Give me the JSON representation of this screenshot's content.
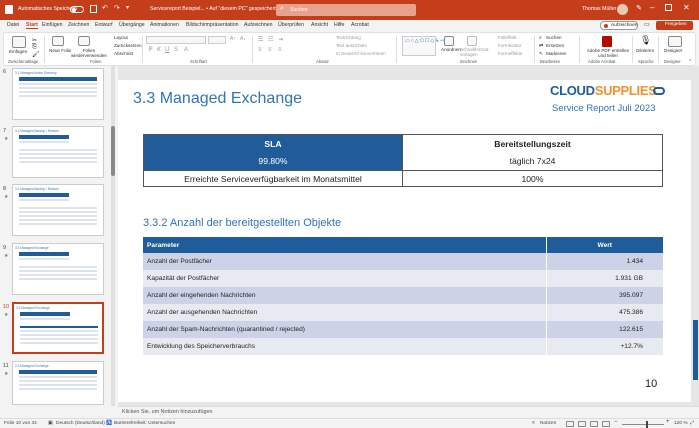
{
  "title_bar": {
    "autosave_label": "Automatisches Speichern",
    "doc_title": "Servicereport Beispiel... • Auf \"diesem PC\" gespeichert",
    "search_placeholder": "Suchen",
    "user_name": "Thomas Müller"
  },
  "ribbon_tabs": [
    "Datei",
    "Start",
    "Einfügen",
    "Zeichnen",
    "Entwurf",
    "Übergänge",
    "Animationen",
    "Bildschirmpräsentation",
    "Aufzeichnen",
    "Überprüfen",
    "Ansicht",
    "Hilfe",
    "Acrobat"
  ],
  "ribbon_right": {
    "record": "Aufzeichnen",
    "share": "Freigeben"
  },
  "ribbon": {
    "paste": "Einfügen",
    "new_slide": "Neue Folie",
    "reuse": "Folien wiederverwenden",
    "layout": "Layout",
    "reset": "Zurücksetzen",
    "section": "Abschnitt",
    "text_direction": "Textrichtung",
    "align_text": "Text ausrichten",
    "smartart": "In SmartArt konvertieren",
    "arrange": "Anordnen",
    "quick_styles": "Schnellformat-vorlagen",
    "fill": "Fülleffekt",
    "outline": "Formkontur",
    "effects": "Formeffekte",
    "find": "Suchen",
    "replace": "Ersetzen",
    "select": "Markieren",
    "pdf": "Adobe PDF erstellen und teilen",
    "dictate": "Diktieren",
    "designer": "Designer",
    "groups": [
      "Zwischenablage",
      "Folien",
      "Schriftart",
      "Absatz",
      "Zeichnen",
      "Bearbeiten",
      "Adobe Acrobat",
      "Sprache",
      "Designer"
    ]
  },
  "thumbnails": [
    {
      "num": "6",
      "title": "3.1 Managed Active Directory"
    },
    {
      "num": "7",
      "title": "3.2 Managed Backup / Restore"
    },
    {
      "num": "8",
      "title": "3.2 Managed Backup / Restore"
    },
    {
      "num": "9",
      "title": "3.3 Managed Exchange"
    },
    {
      "num": "10",
      "title": "3.3 Managed Exchange"
    },
    {
      "num": "11",
      "title": "3.3 Managed Exchange"
    }
  ],
  "slide": {
    "title": "3.3 Managed Exchange",
    "logo_cloud": "CLOUD",
    "logo_supplies": "SUPPLIES",
    "report_title": "Service Report Juli 2023",
    "sla_label": "SLA",
    "sla_value": "99.80%",
    "provision_label": "Bereitstellungszeit",
    "provision_value": "täglich 7x24",
    "availability_label": "Erreichte Serviceverfügbarkeit im Monatsmittel",
    "availability_value": "100%",
    "section_heading": "3.3.2 Anzahl der bereitgestellten Objekte",
    "table_header": {
      "param": "Parameter",
      "value": "Wert"
    },
    "rows": [
      {
        "param": "Anzahl der Postfächer",
        "value": "1.434"
      },
      {
        "param": "Kapazität der Postfächer",
        "value": "1.931 GB"
      },
      {
        "param": "Anzahl der eingehenden Nachrichten",
        "value": "395.097"
      },
      {
        "param": "Anzahl der ausgehenden Nachrichten",
        "value": "475.386"
      },
      {
        "param": "Anzahl der Spam-Nachrichten (quarantined / rejected)",
        "value": "122.615"
      },
      {
        "param": "Entwicklung des Speicherverbrauchs",
        "value": "+12.7%"
      }
    ],
    "page_number": "10"
  },
  "notes_placeholder": "Klicken Sie, um Notizen hinzuzufügen",
  "status": {
    "slide_of": "Folie 10 von 34",
    "language": "Deutsch (Deutschland)",
    "accessibility": "Barrierefreiheit: Untersuchen",
    "notes": "Notizen",
    "zoom": "120 %"
  },
  "colors": {
    "accent": "#c43e1c",
    "table_blue": "#1f5c99",
    "row_a": "#cdd3e7",
    "row_b": "#e8eaf2",
    "title_blue": "#2e75b6",
    "logo_orange": "#f0932b"
  }
}
